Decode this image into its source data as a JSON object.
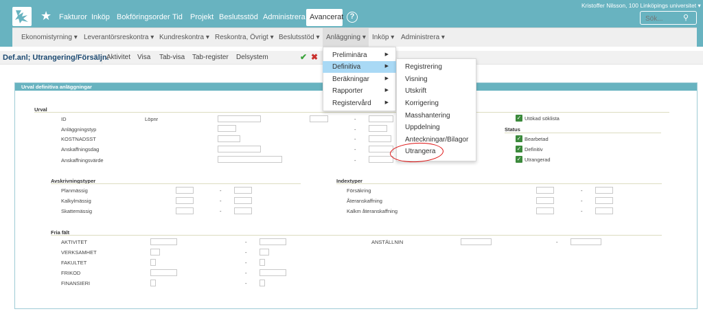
{
  "topnav": {
    "items": [
      "Fakturor",
      "Inköp",
      "Bokföringsorder",
      "Tid",
      "Projekt",
      "Beslutsstöd",
      "Administrera"
    ],
    "active": "Avancerat",
    "user": "Kristoffer Nilsson, 100 Linköpings universitet ▾",
    "search_placeholder": "Sök..."
  },
  "subnav": {
    "items": [
      "Ekonomistyrning ▾",
      "Leverantörsreskontra ▾",
      "Kundreskontra ▾",
      "Reskontra, Övrigt ▾",
      "Beslutsstöd ▾"
    ],
    "active": "Anläggning ▾",
    "after": [
      "Inköp ▾",
      "Administrera ▾"
    ]
  },
  "toolbar": {
    "title": "Def.anl; Utrangering/Försäljn.",
    "items": [
      "Aktivitet",
      "Visa",
      "Tab-visa",
      "Tab-register",
      "Delsystem"
    ]
  },
  "panel": {
    "title": "Urval definitiva anläggningar"
  },
  "urval": {
    "title": "Urval",
    "rows": [
      "ID",
      "Anläggningstyp",
      "KOSTNADSST",
      "Anskaffningsdag",
      "Anskaffningsvärde"
    ],
    "lopnr": "Löpnr",
    "dash": "-"
  },
  "sidechecks": {
    "utokad": "Utökad söklista",
    "status_title": "Status",
    "statuses": [
      "Bearbetad",
      "Definitiv",
      "Utrangerad"
    ]
  },
  "avskrivning": {
    "title": "Avskrivningstyper",
    "rows": [
      "Planmässig",
      "Kalkylmässig",
      "Skattemässig"
    ]
  },
  "index": {
    "title": "Indextyper",
    "rows": [
      "Försäkring",
      "Återanskaffning",
      "Kalkm återanskaffning"
    ]
  },
  "friafalt": {
    "title": "Fria fält",
    "rows": [
      "AKTIVITET",
      "VERKSAMHET",
      "FAKULTET",
      "FRIKOD",
      "FINANSIERI"
    ],
    "extra": "ANSTÄLLNIN"
  },
  "menu1": {
    "items": [
      "Preliminära",
      "Definitiva",
      "Beräkningar",
      "Rapporter",
      "Registervård"
    ]
  },
  "menu2": {
    "items": [
      "Registrering",
      "Visning",
      "Utskrift",
      "Korrigering",
      "Masshantering",
      "Uppdelning",
      "Anteckningar/Bilagor",
      "Utrangera"
    ]
  },
  "colors": {
    "teal": "#68b3c0",
    "highlight": "#a9d9f5",
    "annotation": "#d11111"
  }
}
